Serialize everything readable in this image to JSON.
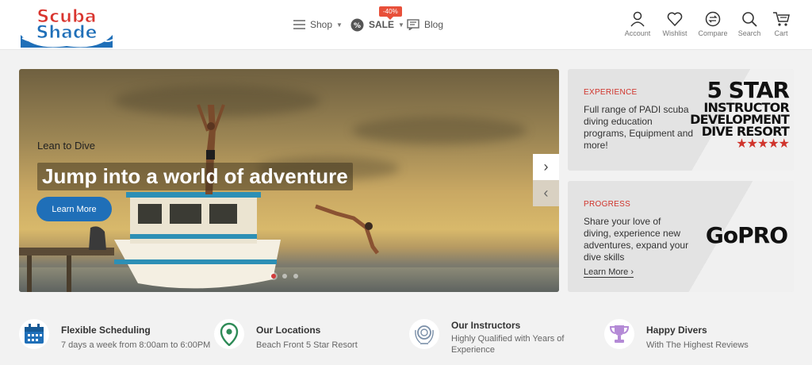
{
  "brand": {
    "line1": "Scuba",
    "line2": "Shade"
  },
  "nav": {
    "shop": "Shop",
    "sale": "SALE",
    "sale_badge": "-40%",
    "blog": "Blog"
  },
  "header_icons": [
    {
      "label": "Account",
      "icon": "user-icon"
    },
    {
      "label": "Wishlist",
      "icon": "heart-icon"
    },
    {
      "label": "Compare",
      "icon": "compare-icon"
    },
    {
      "label": "Search",
      "icon": "search-icon"
    },
    {
      "label": "Cart",
      "icon": "cart-icon"
    }
  ],
  "hero": {
    "subtitle": "Lean to Dive",
    "title": "Jump into a world of adventure",
    "button": "Learn More",
    "slides": 3,
    "active_slide": 1
  },
  "promos": [
    {
      "tag": "EXPERIENCE",
      "text": "Full range of PADI scuba diving education programs, Equipment and more!",
      "badge_line1": "5 STAR",
      "badge_line2": "INSTRUCTOR",
      "badge_line3": "DEVELOPMENT",
      "badge_line4": "DIVE RESORT",
      "stars": "★★★★★"
    },
    {
      "tag": "PROGRESS",
      "text": "Share your love of diving, experience new adventures, expand your dive skills",
      "logo": "GoPRO",
      "link": "Learn More"
    }
  ],
  "features": [
    {
      "title": "Flexible Scheduling",
      "text": "7 days a week from 8:00am to 6:00PM",
      "icon": "calendar-icon"
    },
    {
      "title": "Our Locations",
      "text": "Beach Front 5 Star Resort",
      "icon": "map-pin-icon"
    },
    {
      "title": "Our Instructors",
      "text": "Highly Qualified with Years of Experience",
      "icon": "award-icon"
    },
    {
      "title": "Happy Divers",
      "text": "With The Highest Reviews",
      "icon": "trophy-icon"
    }
  ],
  "colors": {
    "accent": "#d0342c",
    "button": "#1f6fb8",
    "logo_red": "#d9352f",
    "logo_blue": "#1f6fb8"
  }
}
